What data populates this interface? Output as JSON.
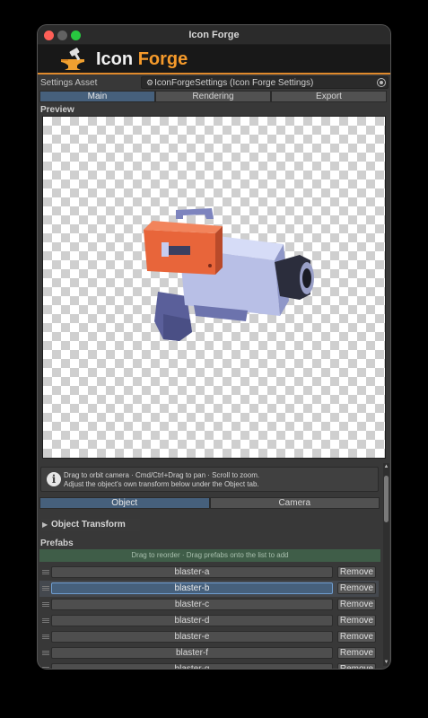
{
  "window": {
    "title": "Icon Forge"
  },
  "banner": {
    "logo_word1": "Icon",
    "logo_word2": "Forge",
    "icon": "anvil-hammer-icon",
    "accent_color": "#f59a2b"
  },
  "settings": {
    "label": "Settings Asset",
    "value": "IconForgeSettings (Icon Forge Settings)",
    "icon": "settings-asset-icon"
  },
  "main_tabs": [
    {
      "label": "Main",
      "active": true
    },
    {
      "label": "Rendering",
      "active": false
    },
    {
      "label": "Export",
      "active": false
    }
  ],
  "preview": {
    "label": "Preview"
  },
  "help": {
    "line1": "Drag to orbit camera · Cmd/Ctrl+Drag to pan · Scroll to zoom.",
    "line2": "Adjust the object's own transform below under the Object tab."
  },
  "sub_tabs": [
    {
      "label": "Object",
      "active": true
    },
    {
      "label": "Camera",
      "active": false
    }
  ],
  "object_transform": {
    "label": "Object Transform"
  },
  "prefabs": {
    "label": "Prefabs",
    "drop_hint": "Drag to reorder · Drag prefabs onto the list to add",
    "remove_label": "Remove",
    "items": [
      {
        "name": "blaster-a",
        "selected": false
      },
      {
        "name": "blaster-b",
        "selected": true
      },
      {
        "name": "blaster-c",
        "selected": false
      },
      {
        "name": "blaster-d",
        "selected": false
      },
      {
        "name": "blaster-e",
        "selected": false
      },
      {
        "name": "blaster-f",
        "selected": false
      },
      {
        "name": "blaster-g",
        "selected": false
      }
    ]
  }
}
